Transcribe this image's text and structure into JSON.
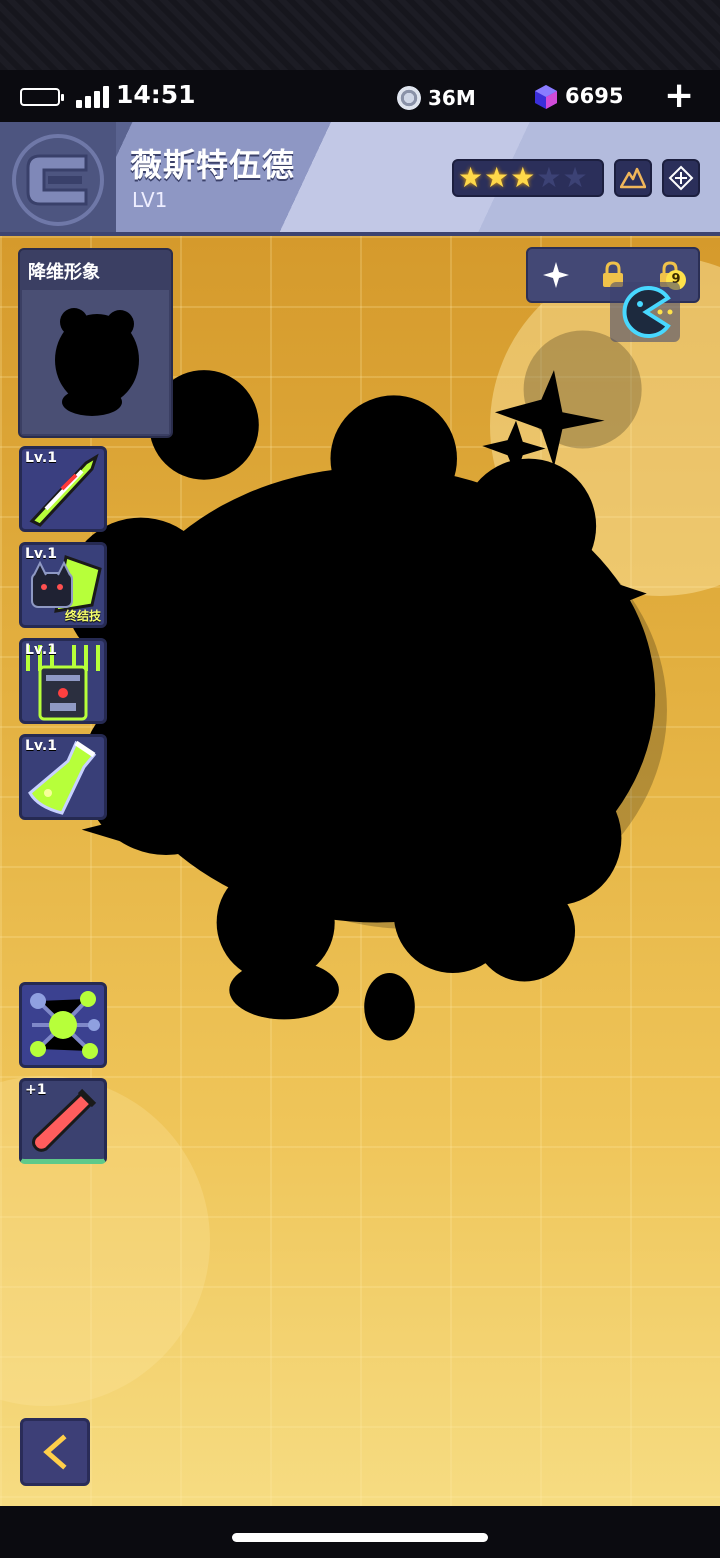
{
  "status_bar": {
    "time": "14:51",
    "coins": "36M",
    "gems": "6695",
    "add_icon": "plus-icon"
  },
  "character": {
    "name": "薇斯特伍德",
    "level": "LV1",
    "stars_total": 5,
    "stars_filled": 3
  },
  "panel": {
    "title": "降维形象"
  },
  "skills": [
    {
      "level": "Lv.1",
      "tag": "",
      "icon": "blade-icon"
    },
    {
      "level": "Lv.1",
      "tag": "终结技",
      "icon": "cat-ultimate-icon"
    },
    {
      "level": "Lv.1",
      "tag": "",
      "icon": "machine-icon"
    },
    {
      "level": "Lv.1",
      "tag": "",
      "icon": "flask-icon"
    }
  ],
  "items": [
    {
      "label": "",
      "icon": "molecule-icon"
    },
    {
      "label": "+1",
      "icon": "test-tube-icon"
    }
  ],
  "toolbar": {
    "badge_count": "9",
    "icons": [
      "sparkle-icon",
      "lock-icon",
      "lock-badge-icon"
    ]
  },
  "colors": {
    "accent_star": "#ffd84a",
    "panel": "#3b3f63",
    "stage_top": "#d59a2c",
    "stage_bottom": "#f6dc82"
  }
}
